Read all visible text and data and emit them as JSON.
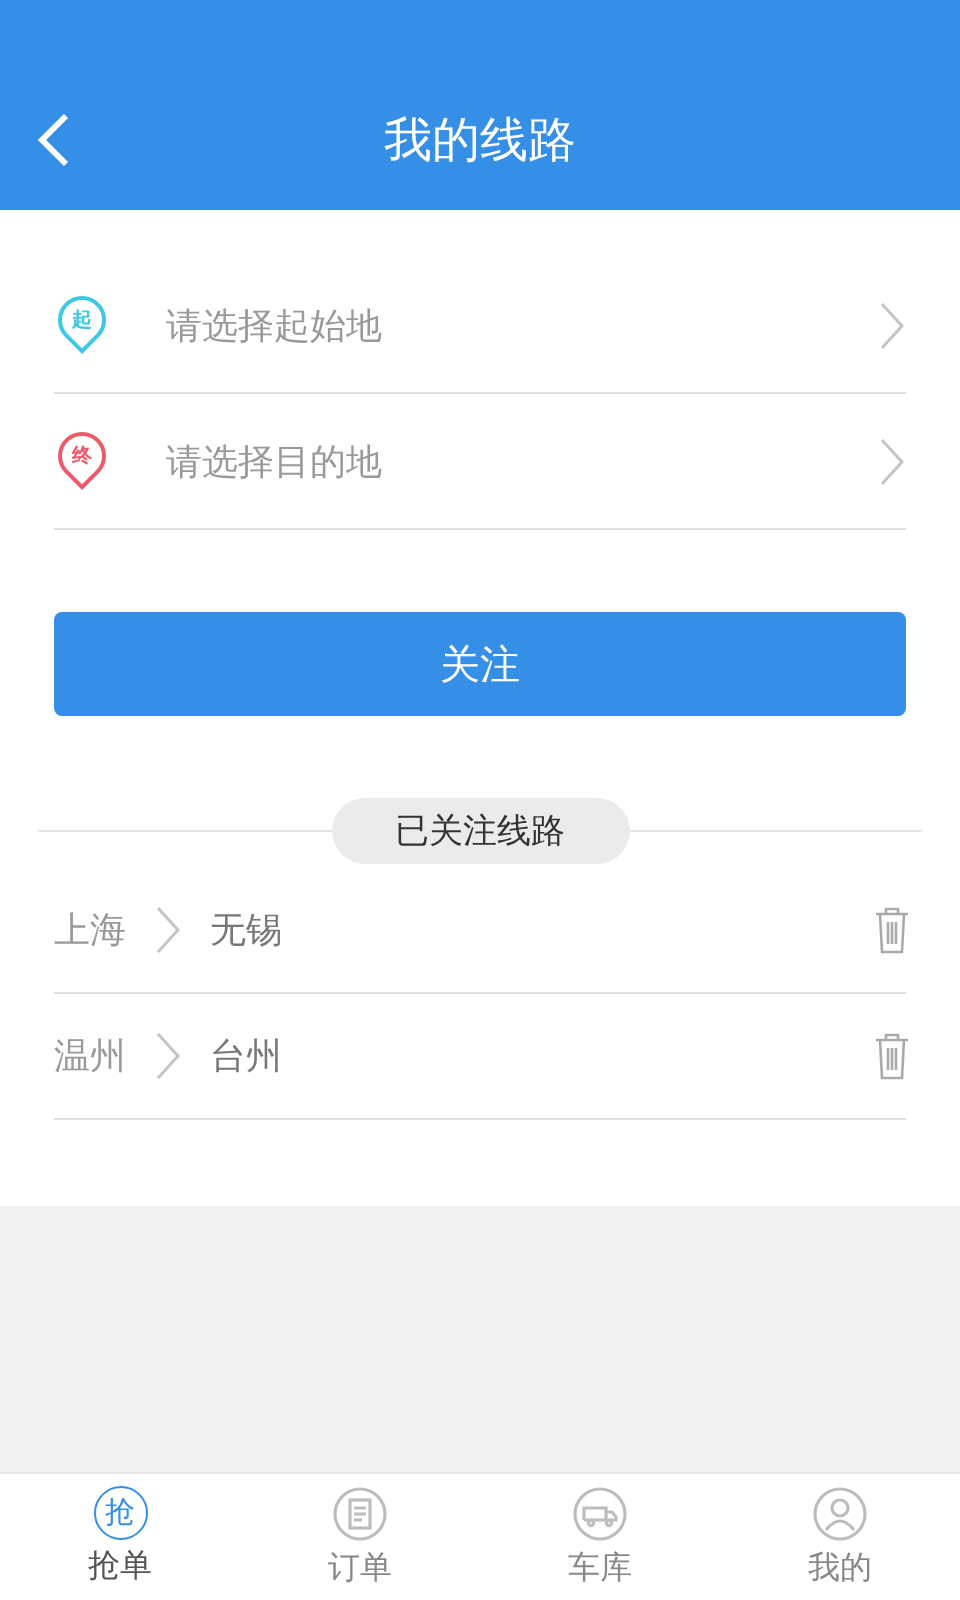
{
  "header": {
    "title": "我的线路"
  },
  "pickers": [
    {
      "badge": "起",
      "color": "#3cc8e6",
      "placeholder": "请选择起始地"
    },
    {
      "badge": "终",
      "color": "#f0596a",
      "placeholder": "请选择目的地"
    }
  ],
  "follow_button": "关注",
  "section_title": "已关注线路",
  "routes": [
    {
      "from": "上海",
      "to": "无锡"
    },
    {
      "from": "温州",
      "to": "台州"
    }
  ],
  "tabs": [
    {
      "kind": "glyph",
      "glyph": "抢",
      "label": "抢单",
      "selected": true
    },
    {
      "kind": "document",
      "label": "订单",
      "selected": false
    },
    {
      "kind": "truck",
      "label": "车库",
      "selected": false
    },
    {
      "kind": "person",
      "label": "我的",
      "selected": false
    }
  ]
}
